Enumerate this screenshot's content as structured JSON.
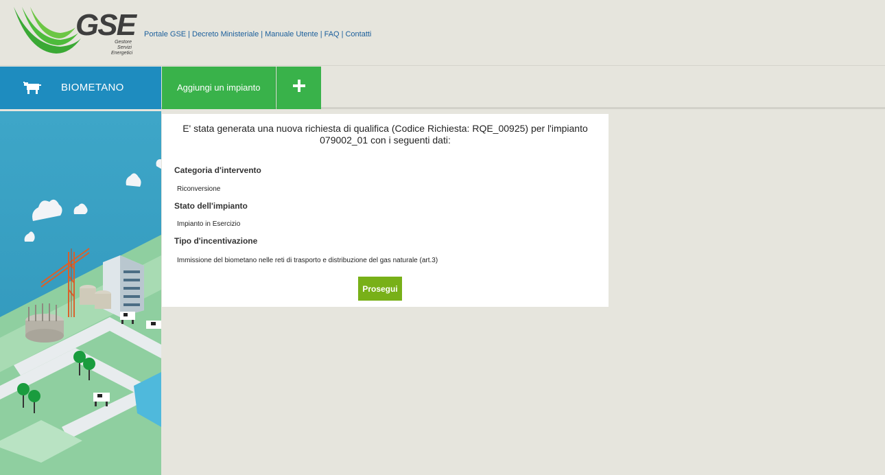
{
  "logo": {
    "title": "GSE",
    "sub": [
      "Gestore",
      "Servizi",
      "Energetici"
    ]
  },
  "toplinks": [
    {
      "label": "Portale GSE"
    },
    {
      "label": "Decreto Ministeriale"
    },
    {
      "label": "Manuale Utente"
    },
    {
      "label": "FAQ"
    },
    {
      "label": "Contatti"
    }
  ],
  "nav": {
    "section_label": "BIOMETANO",
    "section_icon": "cow-icon",
    "add_label": "Aggiungi un impianto",
    "add_icon": "plus-icon"
  },
  "card": {
    "message": "E' stata generata una nuova richiesta di qualifica (Codice Richiesta: RQE_00925) per l'impianto 079002_01 con i seguenti dati:",
    "sections": [
      {
        "title": "Categoria d'intervento",
        "value": "Riconversione"
      },
      {
        "title": "Stato dell'impianto",
        "value": "Impianto in Esercizio"
      },
      {
        "title": "Tipo d'incentivazione",
        "value": "Immissione del biometano nelle reti di trasporto e distribuzione del gas naturale (art.3)"
      }
    ],
    "button_label": "Prosegui"
  },
  "colors": {
    "background": "#e6e5dd",
    "nav_blue": "#1e8cbf",
    "nav_green": "#39b24a",
    "button_green": "#78b018",
    "link_blue": "#1a5e9b"
  }
}
